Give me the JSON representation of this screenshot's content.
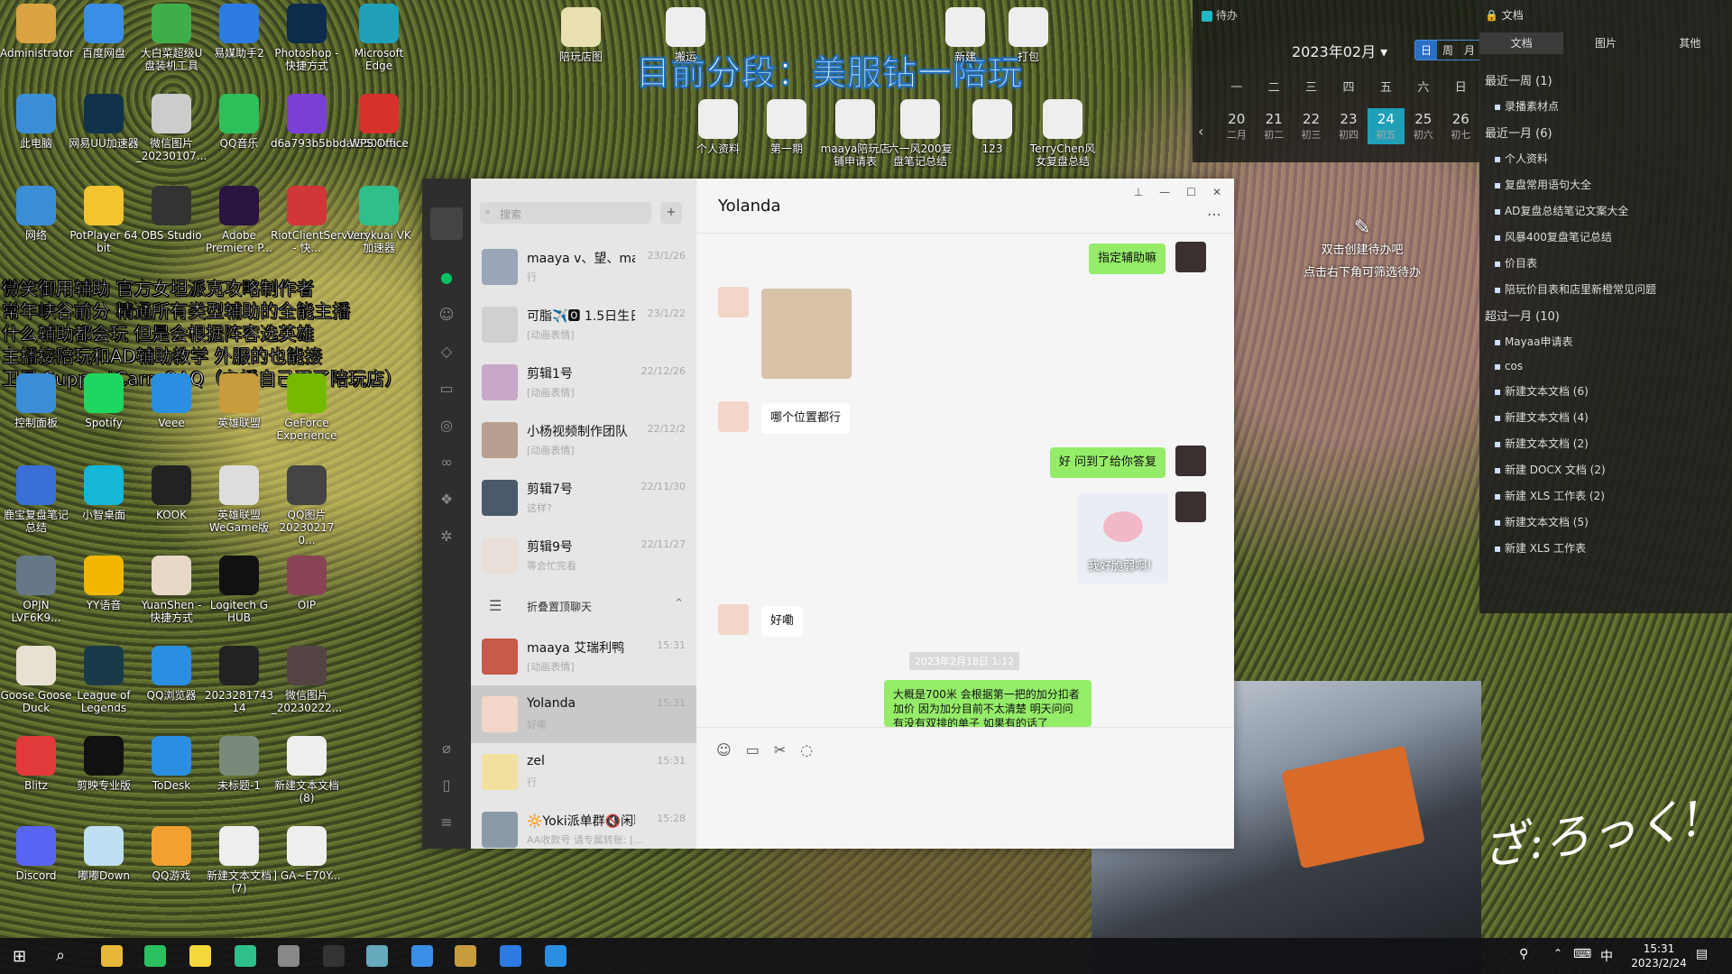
{
  "banner": "目前分段：美服钻一陪玩",
  "overlay_lines": [
    "微笑御用辅助 官方女坦派克攻略制作者",
    "常年峡谷前分 精通所有类型辅助的全能主播",
    "什么辅助都会玩 但是会根据阵容选英雄",
    "主播接陪玩和AD辅助教学 外服的也能接",
    "卫星 SupportCarryQAQ（主播自己开了陪玩店）"
  ],
  "desktop_icons": [
    {
      "label": "Administrator",
      "color": "#d9a441"
    },
    {
      "label": "百度网盘",
      "color": "#3a8ee6"
    },
    {
      "label": "大白菜超级U盘装机工具",
      "color": "#3fae4a"
    },
    {
      "label": "易媒助手2",
      "color": "#2c7be5"
    },
    {
      "label": "Photoshop - 快捷方式",
      "color": "#0b2c4a"
    },
    {
      "label": "Microsoft Edge",
      "color": "#1fa0b8"
    },
    {
      "label": "此电脑",
      "color": "#3b8ed6"
    },
    {
      "label": "网易UU加速器",
      "color": "#12324a"
    },
    {
      "label": "微信图片_20230107...",
      "color": "#cccccc"
    },
    {
      "label": "QQ音乐",
      "color": "#2fbf5a"
    },
    {
      "label": "d6a793b5bbdaf3501ca...",
      "color": "#7b3fd6"
    },
    {
      "label": "WPS Office",
      "color": "#d6322b"
    },
    {
      "label": "网络",
      "color": "#3b8ed6"
    },
    {
      "label": "PotPlayer 64 bit",
      "color": "#f2c530"
    },
    {
      "label": "OBS Studio",
      "color": "#333333"
    },
    {
      "label": "Adobe Premiere P...",
      "color": "#2a1440"
    },
    {
      "label": "RiotClientServices - 快...",
      "color": "#d13639"
    },
    {
      "label": "Verykuai VK加速器",
      "color": "#2fbf8a"
    },
    {
      "label": "控制面板",
      "color": "#3b8ed6"
    },
    {
      "label": "Spotify",
      "color": "#1ed760"
    },
    {
      "label": "Veee",
      "color": "#2a8fe0"
    },
    {
      "label": "英雄联盟",
      "color": "#c89b3c"
    },
    {
      "label": "GeForce Experience",
      "color": "#76b900"
    },
    {
      "label": "鹿宝复盘笔记总结",
      "color": "#3a6fd6"
    },
    {
      "label": "小智桌面",
      "color": "#14b8d6"
    },
    {
      "label": "KOOK",
      "color": "#222222"
    },
    {
      "label": "英雄联盟WeGame版",
      "color": "#dddddd"
    },
    {
      "label": "QQ图片20230217 0...",
      "color": "#444444"
    },
    {
      "label": "OPJN LVF6K9...",
      "color": "#667788"
    },
    {
      "label": "YY语音",
      "color": "#f2b700"
    },
    {
      "label": "YuanShen - 快捷方式",
      "color": "#e8d8c8"
    },
    {
      "label": "Logitech G HUB",
      "color": "#111111"
    },
    {
      "label": "OIP",
      "color": "#884455"
    },
    {
      "label": "Goose Goose Duck",
      "color": "#e8e0d0"
    },
    {
      "label": "League of Legends",
      "color": "#1a3a4a"
    },
    {
      "label": "QQ浏览器",
      "color": "#2a8fe0"
    },
    {
      "label": "2023281743 14",
      "color": "#222222"
    },
    {
      "label": "微信图片_20230222...",
      "color": "#554444"
    },
    {
      "label": "Blitz",
      "color": "#e23a3a"
    },
    {
      "label": "剪映专业版",
      "color": "#111111"
    },
    {
      "label": "ToDesk",
      "color": "#2a8fe0"
    },
    {
      "label": "未标题-1",
      "color": "#7a8a7a"
    },
    {
      "label": "新建文本文档 (8)",
      "color": "#eeeeee"
    },
    {
      "label": "Discord",
      "color": "#5865f2"
    },
    {
      "label": "嘟嘟Down",
      "color": "#bfe0f2"
    },
    {
      "label": "QQ游戏",
      "color": "#f2a030"
    },
    {
      "label": "新建文本文档 (7)",
      "color": "#eeeeee"
    },
    {
      "label": "] GA~E70Y...",
      "color": "#eeeeee"
    },
    {
      "label": "陪玩店图",
      "color": "#e8e0b0"
    },
    {
      "label": "个人资料",
      "color": "#eeeeee"
    },
    {
      "label": "第一期",
      "color": "#eeeeee"
    },
    {
      "label": "maaya陪玩店铺申请表",
      "color": "#eeeeee"
    },
    {
      "label": "六一风200复盘笔记总结",
      "color": "#eeeeee"
    },
    {
      "label": "123",
      "color": "#eeeeee"
    },
    {
      "label": "TerryChen风女复盘总结",
      "color": "#eeeeee"
    },
    {
      "label": "搬运",
      "color": "#eeeeee"
    },
    {
      "label": "新建",
      "color": "#eeeeee"
    },
    {
      "label": "打包",
      "color": "#eeeeee"
    }
  ],
  "calendar": {
    "header_left": "待办",
    "month": "2023年02月",
    "view_buttons": [
      "日",
      "周",
      "月"
    ],
    "weekdays": [
      "一",
      "二",
      "三",
      "四",
      "五",
      "六",
      "日"
    ],
    "days": [
      {
        "d": "20",
        "l": "二月"
      },
      {
        "d": "21",
        "l": "初二"
      },
      {
        "d": "22",
        "l": "初三"
      },
      {
        "d": "23",
        "l": "初四"
      },
      {
        "d": "24",
        "l": "初五"
      },
      {
        "d": "25",
        "l": "初六"
      },
      {
        "d": "26",
        "l": "初七"
      }
    ],
    "hint1": "双击创建待办吧",
    "hint2": "点击右下角可筛选待办"
  },
  "doc_widget": {
    "title": "文档",
    "tabs": [
      "文档",
      "图片",
      "其他"
    ],
    "groups": [
      {
        "name": "最近一周 (1)",
        "items": [
          "录播素材点"
        ]
      },
      {
        "name": "最近一月 (6)",
        "items": [
          "个人资料",
          "复盘常用语句大全",
          "AD复盘总结笔记文案大全",
          "风暴400复盘笔记总结",
          "价目表",
          "陪玩价目表和店里新橙常见问题"
        ]
      },
      {
        "name": "超过一月 (10)",
        "items": [
          "Mayaa申请表",
          "cos",
          "新建文本文档 (6)",
          "新建文本文档 (4)",
          "新建文本文档 (2)",
          "新建 DOCX 文档 (2)",
          "新建 XLS 工作表 (2)",
          "新建文本文档 (5)",
          "新建 XLS 工作表"
        ]
      }
    ]
  },
  "wechat": {
    "search_placeholder": "搜索",
    "add_label": "+",
    "chat_title": "Yolanda",
    "chats": [
      {
        "name": "maaya v、望、ma...",
        "time": "23/1/26",
        "preview": "行"
      },
      {
        "name": "可脂✈️🅾 1.5日生日",
        "time": "23/1/22",
        "preview": "[动画表情]"
      },
      {
        "name": "剪辑1号",
        "time": "22/12/26",
        "preview": "[动画表情]"
      },
      {
        "name": "小杨视频制作团队",
        "time": "22/12/2",
        "preview": "[动画表情]"
      },
      {
        "name": "剪辑7号",
        "time": "22/11/30",
        "preview": "这样?"
      },
      {
        "name": "剪辑9号",
        "time": "22/11/27",
        "preview": "等会忙完看"
      },
      {
        "name": "折叠置顶聊天",
        "time": "",
        "preview": ""
      },
      {
        "name": "maaya 艾瑞利鸭",
        "time": "15:31",
        "preview": "[动画表情]"
      },
      {
        "name": "Yolanda",
        "time": "15:31",
        "preview": "好嘞"
      },
      {
        "name": "zel",
        "time": "15:31",
        "preview": "行"
      },
      {
        "name": "🔆Yoki派单群🔇闲聊",
        "time": "15:28",
        "preview": "AA收款号 请专属转账: [..."
      }
    ],
    "messages": [
      {
        "text": "指定辅助嘛"
      },
      {
        "text": "哪个位置都行"
      },
      {
        "text": "好 问到了给你答复"
      },
      {
        "text": "我好脆弱啊！"
      },
      {
        "text": "好嘞"
      },
      {
        "text": "2023年2月18日 1:12"
      },
      {
        "text": "大概是700米 会根据第一把的加分扣者加价 因为加分目前不太清楚 明天问问有没有双排的单子 如果有的话了"
      }
    ]
  },
  "webcam_text": "ざ:ろっく!",
  "taskbar": {
    "lang": "中",
    "time": "15:31",
    "date": "2023/2/24"
  }
}
